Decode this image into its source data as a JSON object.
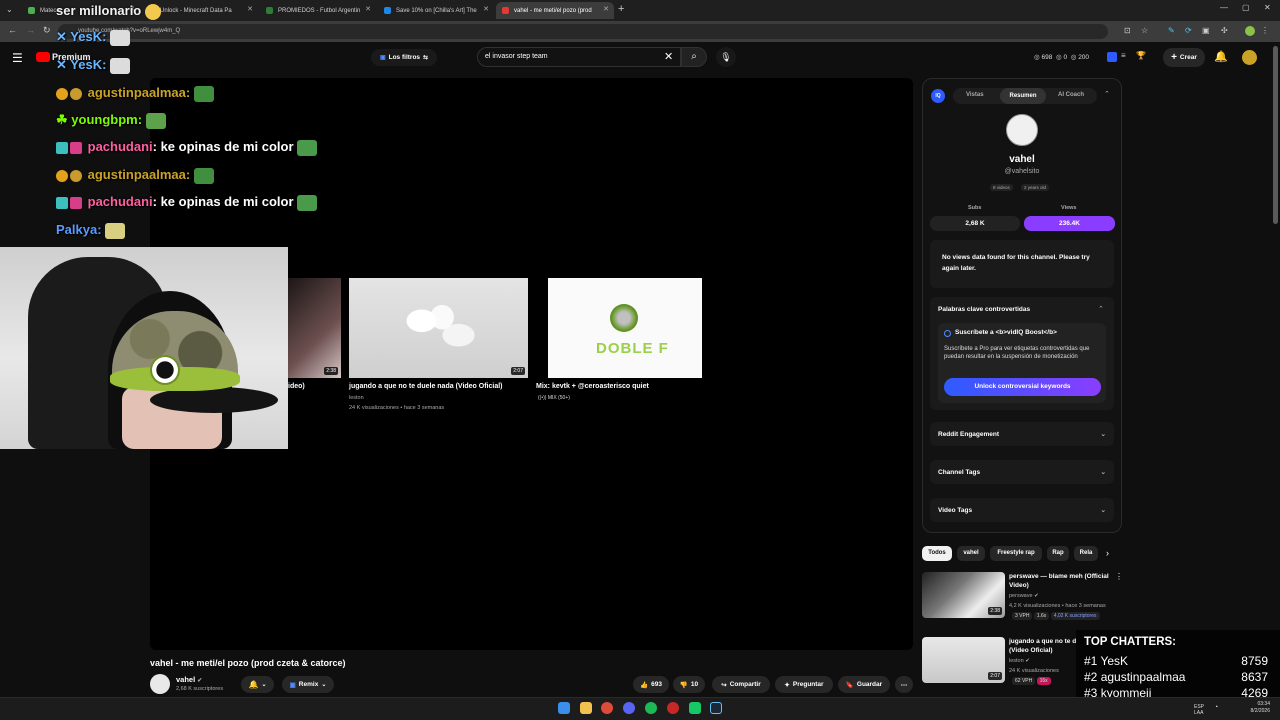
{
  "browser": {
    "tabs": [
      {
        "label": "Matecar",
        "color": "#4caf50"
      },
      {
        "label": "Unlock - Minecraft Data Pa",
        "color": "#8bc34a"
      },
      {
        "label": "PROMIEDOS - Futbol Argentin",
        "color": "#2e7d32"
      },
      {
        "label": "Save 10% on [Chilla's Art] The",
        "color": "#1e88e5"
      },
      {
        "label": "vahel - me meti/el pozo (prod",
        "color": "#e53935"
      }
    ],
    "url": "youtube.com/watch?v=oRLewjw4m_Q"
  },
  "youtube": {
    "brand": "Premium",
    "filters_label": "Los filtros",
    "search_value": "el invasor step team",
    "stats": {
      "a": "698",
      "b": "0",
      "c": "200"
    },
    "create_label": "Crear"
  },
  "recommended_row": [
    {
      "title": "ideo)",
      "duration": "2:38"
    },
    {
      "title": "jugando a que no te duele nada (Video Oficial)",
      "channel": "leston",
      "meta": "24 K visualizaciones • hace 3 semanas",
      "duration": "2:07"
    },
    {
      "title": "Mix: kevtk + @ceroasterisco quiet",
      "meta": "MIX (50+)",
      "thumb_text": "DOBLE F"
    }
  ],
  "video": {
    "title": "vahel - me meti/el pozo (prod czeta & catorce)",
    "channel": "vahel",
    "subs": "2,68 K suscriptores",
    "remix_label": "Remix",
    "likes": "693",
    "dislikes": "10",
    "share": "Compartir",
    "ask": "Preguntar",
    "save": "Guardar"
  },
  "chat": {
    "header": "ser millonario",
    "lines": [
      {
        "user": "YesK:",
        "text": "",
        "color": "#6ab7ff"
      },
      {
        "user": "YesK:",
        "text": "",
        "color": "#6ab7ff"
      },
      {
        "user": "agustinpaalmaa:",
        "text": "",
        "color": "#c9a227"
      },
      {
        "user": "youngbpm:",
        "text": "",
        "color": "#7cfc00"
      },
      {
        "user": "pachudani",
        "text": ": ke opinas de mi color",
        "color": "#ff5fa2"
      },
      {
        "user": "agustinpaalmaa:",
        "text": "",
        "color": "#c9a227"
      },
      {
        "user": "pachudani",
        "text": ": ke opinas de mi color",
        "color": "#ff5fa2"
      },
      {
        "user": "Palkya:",
        "text": "",
        "color": "#5a9bff"
      }
    ]
  },
  "vidiq": {
    "tabs": [
      "Vistas",
      "Resumen",
      "AI Coach"
    ],
    "channel_name": "vahel",
    "handle": "@vahelsito",
    "videos_count": "8 videos",
    "age": "2 years old",
    "subs_label": "Subs",
    "subs_value": "2,68 K",
    "views_label": "Views",
    "views_value": "236.4K",
    "no_data": "No views data found for this channel. Please try again later.",
    "sections": {
      "controversial": "Palabras clave controvertidas",
      "boost_title": "Suscríbete a <b>vidIQ Boost</b>",
      "boost_desc": "Suscríbete a Pro para ver etiquetas controvertidas que puedan resultar en la suspensión de monetización",
      "unlock": "Unlock controversial keywords",
      "reddit": "Reddit Engagement",
      "channel_tags": "Channel Tags",
      "video_tags": "Video Tags"
    }
  },
  "chips": [
    "Todos",
    "vahel",
    "Freestyle rap",
    "Rap",
    "Rela"
  ],
  "sidebar_videos": [
    {
      "title": "perswave — blame meh (Official Video)",
      "channel": "perswave",
      "meta": "4,2 K visualizaciones • hace 3 semanas",
      "duration": "2:38",
      "vph": "3 VPH",
      "mult": "1.6x",
      "subs": "4,02 K suscriptores"
    },
    {
      "title": "jugando a que no te d (Video Oficial)",
      "channel": "leston",
      "meta": "24 K visualizaciones",
      "duration": "2:07",
      "vph": "62 VPH",
      "mult": "16x"
    }
  ],
  "top_chatters": {
    "title": "TOP CHATTERS:",
    "rows": [
      {
        "rank": "#1",
        "name": "YesK",
        "count": "8759"
      },
      {
        "rank": "#2",
        "name": "agustinpaalmaa",
        "count": "8637"
      },
      {
        "rank": "#3",
        "name": "kyommeii",
        "count": "4269"
      }
    ]
  },
  "taskbar": {
    "lang": "ESP LAA",
    "time": "03:34",
    "date": "8/2/2026"
  }
}
